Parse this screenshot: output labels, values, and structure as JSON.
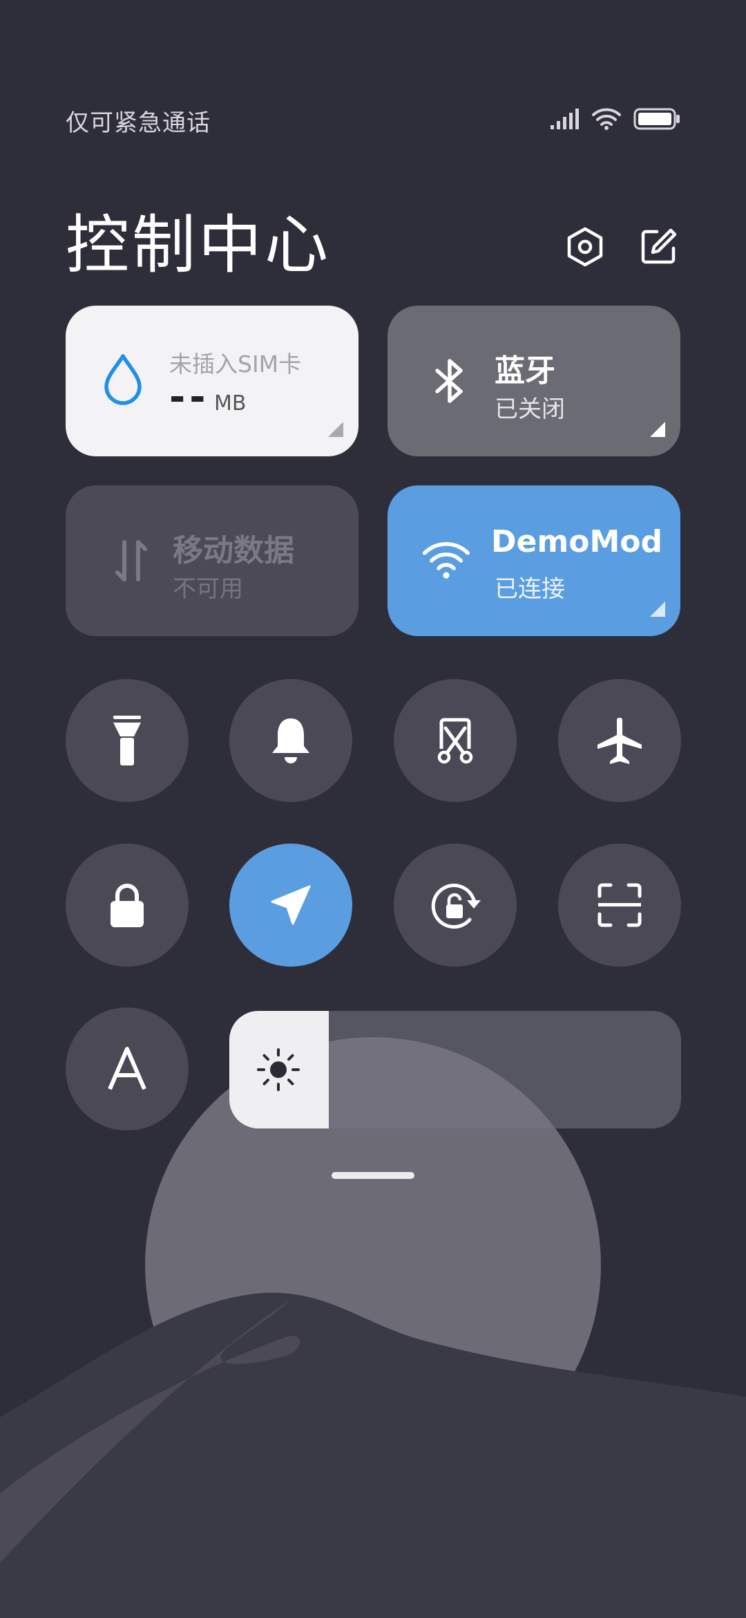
{
  "status_bar": {
    "carrier_text": "仅可紧急通话",
    "icons": [
      "signal-icon",
      "wifi-icon",
      "battery-icon"
    ]
  },
  "header": {
    "title": "控制中心",
    "settings_icon": "settings-icon",
    "edit_icon": "edit-icon"
  },
  "tiles": {
    "data_usage": {
      "label": "未插入SIM卡",
      "value": "--",
      "unit": "MB",
      "icon": "water-drop-icon"
    },
    "bluetooth": {
      "label": "蓝牙",
      "status": "已关闭",
      "icon": "bluetooth-icon"
    },
    "mobile_data": {
      "label": "移动数据",
      "status": "不可用",
      "icon": "data-arrows-icon"
    },
    "wifi": {
      "label": "DemoMod",
      "status": "已连接",
      "icon": "wifi-icon"
    }
  },
  "toggles": [
    {
      "name": "flashlight",
      "icon": "flashlight-icon",
      "active": false
    },
    {
      "name": "silent",
      "icon": "bell-icon",
      "active": false
    },
    {
      "name": "screenshot",
      "icon": "screenshot-icon",
      "active": false
    },
    {
      "name": "airplane",
      "icon": "airplane-icon",
      "active": false
    },
    {
      "name": "lock",
      "icon": "lock-icon",
      "active": false
    },
    {
      "name": "location",
      "icon": "location-icon",
      "active": true
    },
    {
      "name": "auto-rotate",
      "icon": "rotation-lock-icon",
      "active": false
    },
    {
      "name": "scanner",
      "icon": "scan-icon",
      "active": false
    },
    {
      "name": "auto-brightness",
      "icon": "auto-brightness-icon",
      "label": "A",
      "active": false
    }
  ],
  "brightness": {
    "level": 0.22,
    "icon": "sun-icon"
  },
  "colors": {
    "background": "#2e2d3a",
    "accent": "#5a9ee1",
    "button": "#4a4955",
    "tile_inactive": "#6b6b73",
    "tile_disabled": "#4b4a56",
    "data_tile": "#f3f3f5",
    "drop_icon": "#1f8fe8"
  }
}
